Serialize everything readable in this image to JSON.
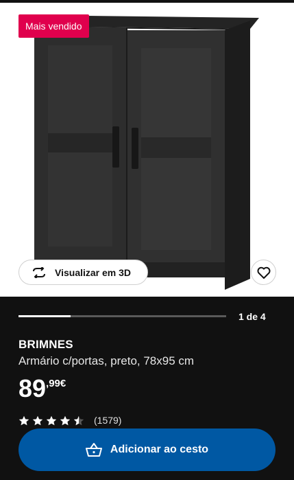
{
  "badge": {
    "label": "Mais vendido"
  },
  "image_actions": {
    "view_3d_label": "Visualizar em 3D",
    "favorite_icon": "heart-icon"
  },
  "gallery": {
    "counter": "1 de 4",
    "progress": 0.25
  },
  "product": {
    "name": "BRIMNES",
    "description": "Armário c/portas, preto, 78x95 cm",
    "price_integer": "89",
    "price_decimal": ",99€",
    "rating": 4.5,
    "rating_max": 5,
    "review_count": "(1579)"
  },
  "cart": {
    "label": "Adicionar ao cesto",
    "icon": "basket-icon"
  },
  "colors": {
    "badge": "#e0004d",
    "primary": "#0058a3",
    "background": "#111111"
  }
}
